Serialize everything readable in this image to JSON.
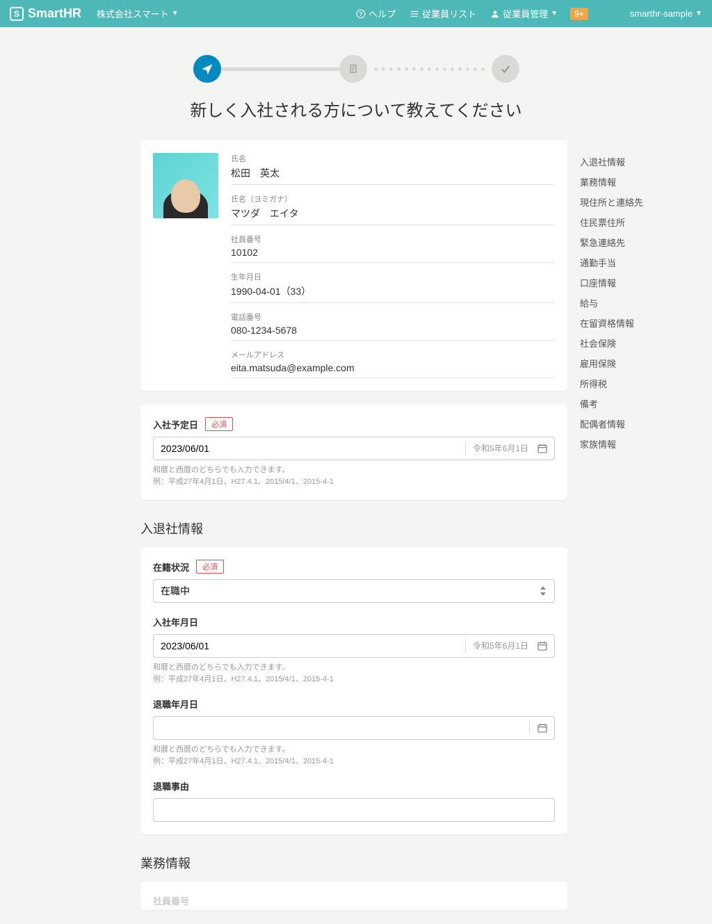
{
  "header": {
    "logo_text": "SmartHR",
    "company": "株式会社スマート",
    "help": "ヘルプ",
    "employee_list": "従業員リスト",
    "employee_mgmt": "従業員管理",
    "notif_badge": "9+",
    "user": "smarthr-sample"
  },
  "page_title": "新しく入社される方について教えてください",
  "profile": {
    "fields": [
      {
        "label": "氏名",
        "value": "松田　英太"
      },
      {
        "label": "氏名（ヨミガナ）",
        "value": "マツダ　エイタ"
      },
      {
        "label": "社員番号",
        "value": "10102"
      },
      {
        "label": "生年月日",
        "value": "1990-04-01（33）"
      },
      {
        "label": "電話番号",
        "value": "080-1234-5678"
      },
      {
        "label": "メールアドレス",
        "value": "eita.matsuda@example.com"
      }
    ]
  },
  "required_label": "必須",
  "date_help_line1": "和暦と西暦のどちらでも入力できます。",
  "date_help_line2": "例：平成27年4月1日、H27.4.1、2015/4/1、2015-4-1",
  "planned_join": {
    "label": "入社予定日",
    "value": "2023/06/01",
    "wareki": "令和5年6月1日"
  },
  "section_employment": "入退社情報",
  "employment_status": {
    "label": "在籍状況",
    "value": "在職中"
  },
  "join_date": {
    "label": "入社年月日",
    "value": "2023/06/01",
    "wareki": "令和5年6月1日"
  },
  "leave_date": {
    "label": "退職年月日",
    "value": ""
  },
  "leave_reason": {
    "label": "退職事由",
    "value": ""
  },
  "section_work": "業務情報",
  "employee_number": {
    "label": "社員番号"
  },
  "sidenav": [
    "入退社情報",
    "業務情報",
    "現住所と連絡先",
    "住民票住所",
    "緊急連絡先",
    "通勤手当",
    "口座情報",
    "給与",
    "在留資格情報",
    "社会保険",
    "雇用保険",
    "所得税",
    "備考",
    "配偶者情報",
    "家族情報"
  ]
}
